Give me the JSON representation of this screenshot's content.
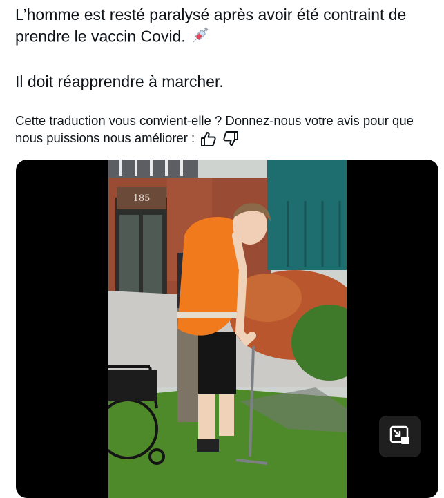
{
  "tweet": {
    "line1": "L’homme est resté paralysé après avoir été contraint de prendre le vaccin Covid.",
    "syringe_icon": "syringe-emoji",
    "line2": "Il doit réapprendre à marcher."
  },
  "translation_feedback": {
    "text": "Cette traduction vous convient-elle ? Donnez-nous votre avis pour que nous puissions nous améliorer :",
    "like_icon": "thumbs-up-icon",
    "dislike_icon": "thumbs-down-icon"
  },
  "media": {
    "type": "video",
    "building_number": "185",
    "pip_icon": "picture-in-picture-icon"
  },
  "colors": {
    "text": "#0f1419",
    "video_background": "#000000",
    "shirt": "#f07a1c",
    "grass": "#4f8a2a"
  }
}
